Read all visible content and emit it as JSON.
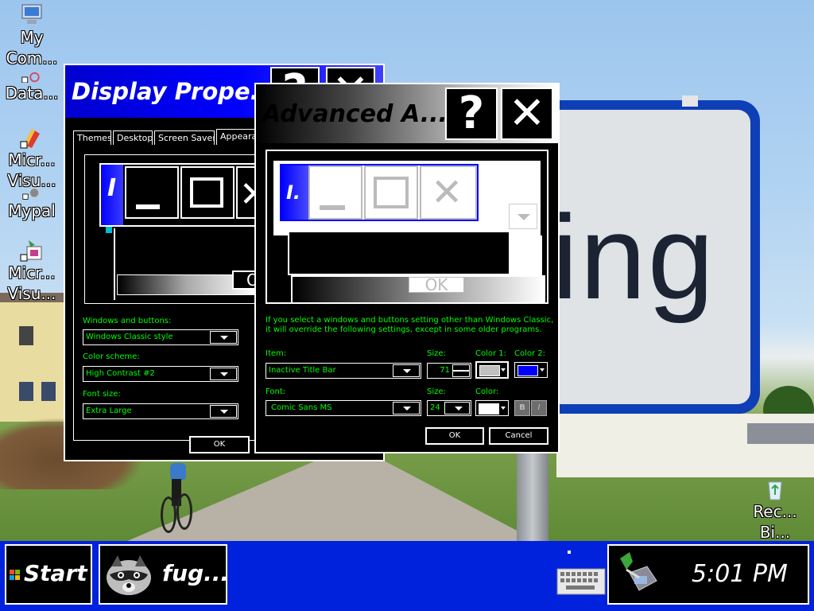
{
  "desktop": {
    "icons": [
      {
        "name": "computer-icon",
        "label_line1": "My",
        "label_line2": "Com..."
      },
      {
        "name": "database-icon",
        "label_line1": "",
        "label_line2": "Data..."
      },
      {
        "name": "visual-studio-icon",
        "label_line1": "Micr...",
        "label_line2": "Visu..."
      },
      {
        "name": "gear-icon",
        "label_line1": "",
        "label_line2": "Mypal"
      },
      {
        "name": "visual-studio-icon",
        "label_line1": "Micr...",
        "label_line2": "Visu..."
      },
      {
        "name": "recycle-bin-icon",
        "label_line1": "Rec...",
        "label_line2": "Bi..."
      }
    ],
    "sign_text": "ing"
  },
  "display_properties": {
    "title": "Display Prope...",
    "help_glyph": "?",
    "close_glyph": "✕",
    "tabs": [
      "Themes",
      "Desktop",
      "Screen Saver",
      "Appearance"
    ],
    "preview": {
      "title_glyph": "I",
      "minimize_glyph": "_",
      "close_glyph": "✕",
      "ok_partial": "O"
    },
    "windows_and_buttons_label": "Windows and buttons:",
    "windows_and_buttons_value": "Windows Classic style",
    "color_scheme_label": "Color scheme:",
    "color_scheme_value": "High Contrast #2",
    "font_size_label": "Font size:",
    "font_size_value": "Extra Large",
    "ok_label": "OK"
  },
  "advanced_appearance": {
    "title": "Advanced A...",
    "help_glyph": "?",
    "close_glyph": "✕",
    "preview": {
      "title_glyph": "I.",
      "ok_label": "OK"
    },
    "info_text_line1": "If you select a windows and buttons setting other than Windows Classic,",
    "info_text_line2": "it will override the following settings, except in some older programs.",
    "item_label": "Item:",
    "item_value": "Inactive Title Bar",
    "size_label": "Size:",
    "size_value": "71",
    "color1_label": "Color 1:",
    "color2_label": "Color 2:",
    "font_label": "Font:",
    "font_value": "Comic Sans MS",
    "font_size_label": "Size:",
    "font_size_value": "24",
    "font_color_label": "Color:",
    "bold_label": "B",
    "italic_label": "I",
    "ok_label": "OK",
    "cancel_label": "Cancel",
    "colors": {
      "color1": "#c0c0c0",
      "color2": "#0000ff",
      "font_color": "#ffffff"
    }
  },
  "taskbar": {
    "start_label": "Start",
    "task_label": "fug...",
    "clock": "5:01 PM"
  },
  "colors": {
    "accent": "#0000ff",
    "hc_text": "#00ff00",
    "taskbar": "#0022dd"
  }
}
